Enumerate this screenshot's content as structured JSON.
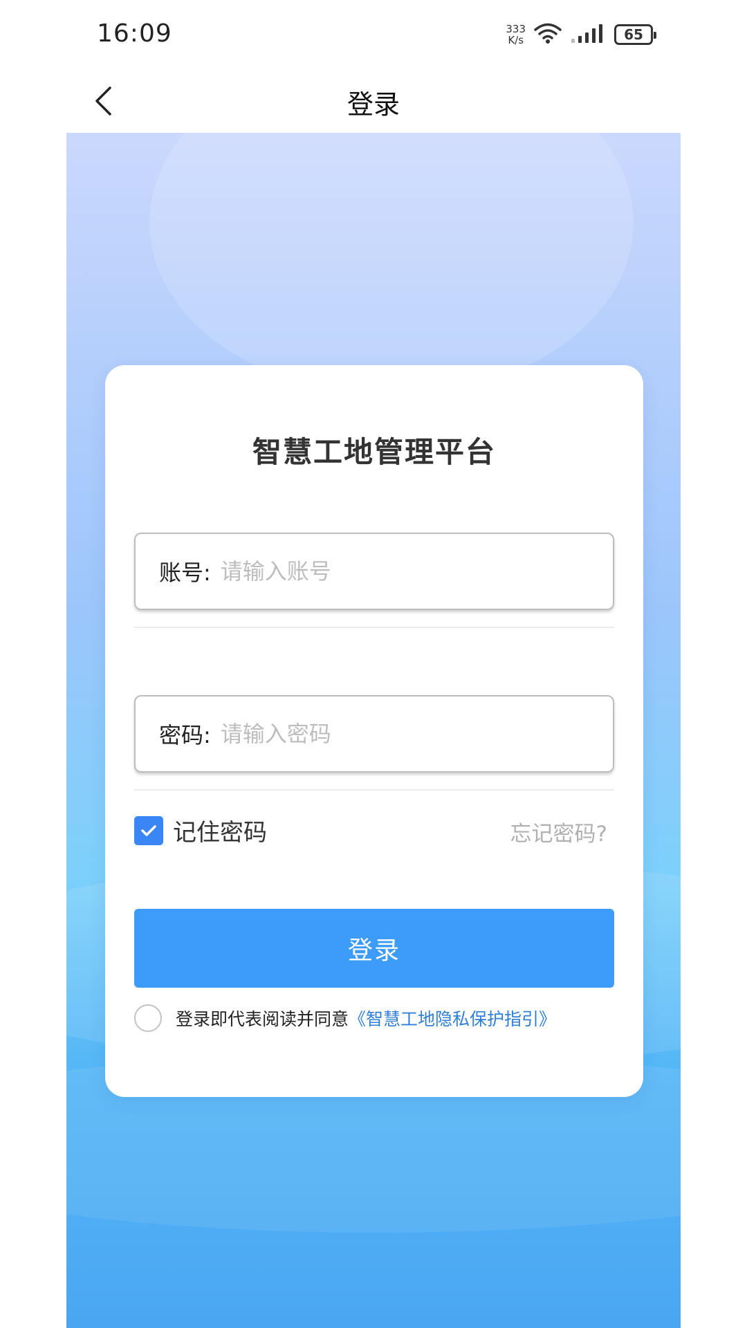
{
  "status_bar": {
    "time": "16:09",
    "net_speed_value": "333",
    "net_speed_unit": "K/s",
    "battery": "65",
    "icons": [
      "wifi-icon",
      "signal-icon",
      "battery-icon"
    ]
  },
  "nav": {
    "title": "登录",
    "back_icon": "chevron-left-icon"
  },
  "card": {
    "title": "智慧工地管理平台",
    "account": {
      "label": "账号:",
      "placeholder": "请输入账号",
      "value": ""
    },
    "password": {
      "label": "密码:",
      "placeholder": "请输入密码",
      "value": ""
    },
    "remember": {
      "label": "记住密码",
      "checked": true
    },
    "forgot_label": "忘记密码?",
    "login_label": "登录",
    "agreement": {
      "checked": false,
      "text": "登录即代表阅读并同意",
      "link": "《智慧工地隐私保护指引》"
    }
  },
  "colors": {
    "accent": "#3d9bf9",
    "checkbox": "#3b86f6",
    "link": "#2f7fd8",
    "placeholder": "#bdbdbd"
  }
}
